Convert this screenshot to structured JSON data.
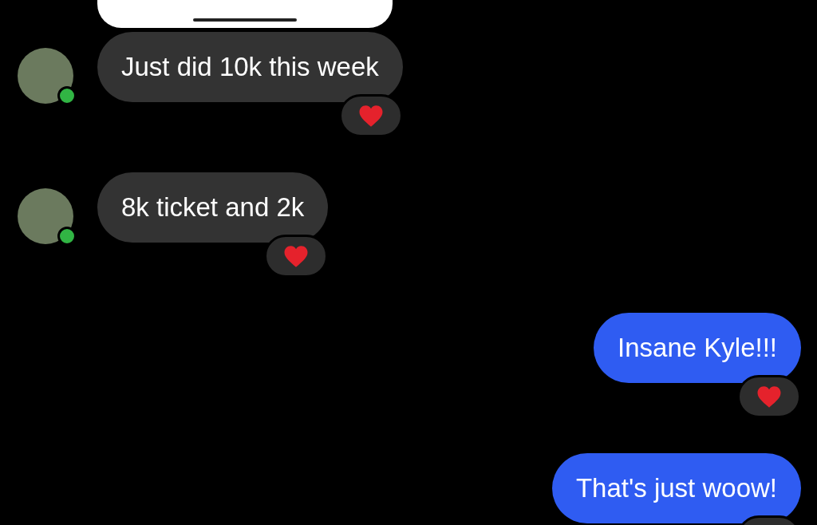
{
  "messages": [
    {
      "kind": "attachment"
    },
    {
      "kind": "incoming",
      "text": "Just did 10k this week",
      "online": true,
      "reacted": true
    },
    {
      "kind": "incoming",
      "text": "8k ticket and 2k",
      "online": true,
      "reacted": true
    },
    {
      "kind": "outgoing",
      "text": "Insane Kyle!!!",
      "reacted": true
    },
    {
      "kind": "outgoing",
      "text": "That's just woow!",
      "reacted": true
    }
  ]
}
